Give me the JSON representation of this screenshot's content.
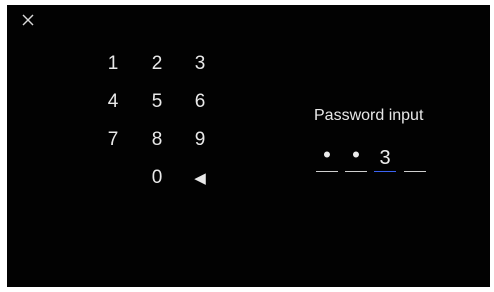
{
  "keypad": {
    "keys": [
      "1",
      "2",
      "3",
      "4",
      "5",
      "6",
      "7",
      "8",
      "9",
      "0"
    ],
    "backspace_glyph": "◀"
  },
  "password": {
    "title": "Password input",
    "slots": [
      "•",
      "•",
      "3",
      ""
    ],
    "active_slot": 2
  },
  "colors": {
    "background": "#020202",
    "text": "#e9e9e9",
    "underline": "#cfcfcf",
    "active_underline": "#3b63f2"
  },
  "icons": {
    "close": "close-icon",
    "backspace": "backspace-icon"
  }
}
